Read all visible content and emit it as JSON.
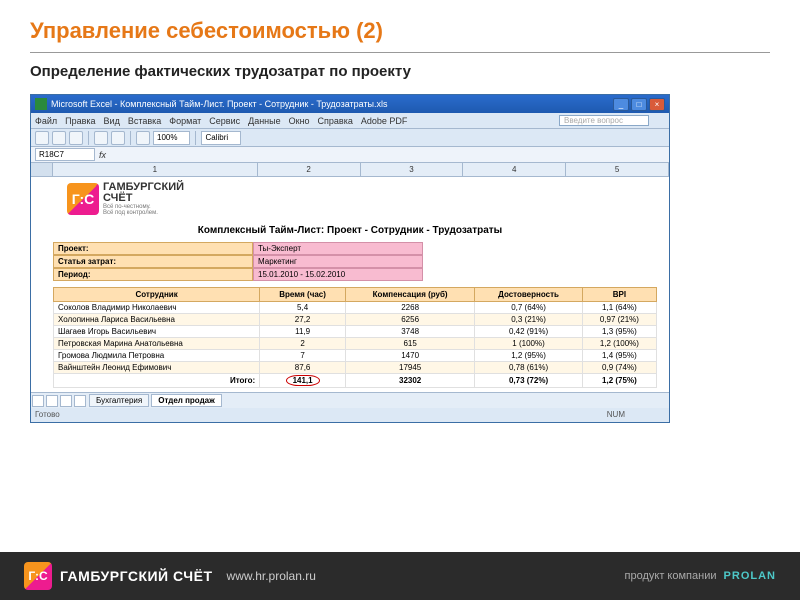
{
  "slide": {
    "title": "Управление себестоимостью (2)",
    "subtitle": "Определение фактических трудозатрат по проекту"
  },
  "window": {
    "title": "Microsoft Excel - Комплексный Тайм-Лист. Проект - Сотрудник - Трудозатраты.xls",
    "menu": [
      "Файл",
      "Правка",
      "Вид",
      "Вставка",
      "Формат",
      "Сервис",
      "Данные",
      "Окно",
      "Справка",
      "Adobe PDF"
    ],
    "ask_placeholder": "Введите вопрос",
    "zoom": "100%",
    "font": "Calibri",
    "namebox": "R18C7",
    "columns": [
      "1",
      "2",
      "3",
      "4",
      "5"
    ],
    "status": "Готово",
    "num": "NUM",
    "tabs": [
      "Бухгалтерия",
      "Отдел продаж"
    ]
  },
  "logo": {
    "mark": "Г:С",
    "name": "ГАМБУРГСКИЙ",
    "name2": "СЧЁТ",
    "tag1": "Всё по-честному.",
    "tag2": "Всё под контролем.",
    "url": "www.hr.prolan.ru"
  },
  "report": {
    "title_label": "Комплексный Тайм-Лист:",
    "title_value": "Проект - Сотрудник - Трудозатраты",
    "meta": [
      {
        "row": "10",
        "label": "Проект:",
        "value": "Ты-Эксперт"
      },
      {
        "row": "11",
        "label": "Статья затрат:",
        "value": "Маркетинг"
      },
      {
        "row": "12",
        "label": "Период:",
        "value": "15.01.2010 - 15.02.2010"
      }
    ],
    "headers": [
      "Сотрудник",
      "Время (час)",
      "Компенсация (руб)",
      "Достоверность",
      "BPI"
    ],
    "rows": [
      {
        "r": "15",
        "name": "Соколов Владимир Николаевич",
        "time": "5,4",
        "comp": "2268",
        "conf": "0,7 (64%)",
        "bpi": "1,1 (64%)"
      },
      {
        "r": "16",
        "name": "Холопинна Лариса Васильевна",
        "time": "27,2",
        "comp": "6256",
        "conf": "0,3 (21%)",
        "bpi": "0,97 (21%)"
      },
      {
        "r": "17",
        "name": "Шагаев Игорь Васильевич",
        "time": "11,9",
        "comp": "3748",
        "conf": "0,42 (91%)",
        "bpi": "1,3 (95%)"
      },
      {
        "r": "18",
        "name": "Петровская Марина Анатольевна",
        "time": "2",
        "comp": "615",
        "conf": "1 (100%)",
        "bpi": "1,2 (100%)"
      },
      {
        "r": "19",
        "name": "Громова Людмила Петровна",
        "time": "7",
        "comp": "1470",
        "conf": "1,2 (95%)",
        "bpi": "1,4 (95%)"
      },
      {
        "r": "20",
        "name": "Вайнштейн Леонид Ефимович",
        "time": "87,6",
        "comp": "17945",
        "conf": "0,78 (61%)",
        "bpi": "0,9 (74%)"
      }
    ],
    "total": {
      "r": "21",
      "label": "Итого:",
      "time": "141,1",
      "comp": "32302",
      "conf": "0,73 (72%)",
      "bpi": "1,2 (75%)"
    }
  },
  "footer": {
    "mark": "Г:С",
    "brand": "ГАМБУРГСКИЙ СЧЁТ",
    "url": "www.hr.prolan.ru",
    "product_label": "продукт компании",
    "company": "PROLAN"
  },
  "chart_data": {
    "type": "table",
    "title": "Комплексный Тайм-Лист: Проект - Сотрудник - Трудозатраты",
    "columns": [
      "Сотрудник",
      "Время (час)",
      "Компенсация (руб)",
      "Достоверность",
      "BPI"
    ],
    "rows": [
      [
        "Соколов Владимир Николаевич",
        5.4,
        2268,
        "0,7 (64%)",
        "1,1 (64%)"
      ],
      [
        "Холопинна Лариса Васильевна",
        27.2,
        6256,
        "0,3 (21%)",
        "0,97 (21%)"
      ],
      [
        "Шагаев Игорь Васильевич",
        11.9,
        3748,
        "0,42 (91%)",
        "1,3 (95%)"
      ],
      [
        "Петровская Марина Анатольевна",
        2,
        615,
        "1 (100%)",
        "1,2 (100%)"
      ],
      [
        "Громова Людмила Петровна",
        7,
        1470,
        "1,2 (95%)",
        "1,4 (95%)"
      ],
      [
        "Вайнштейн Леонид Ефимович",
        87.6,
        17945,
        "0,78 (61%)",
        "0,9 (74%)"
      ]
    ],
    "totals": [
      "Итого:",
      141.1,
      32302,
      "0,73 (72%)",
      "1,2 (75%)"
    ]
  }
}
